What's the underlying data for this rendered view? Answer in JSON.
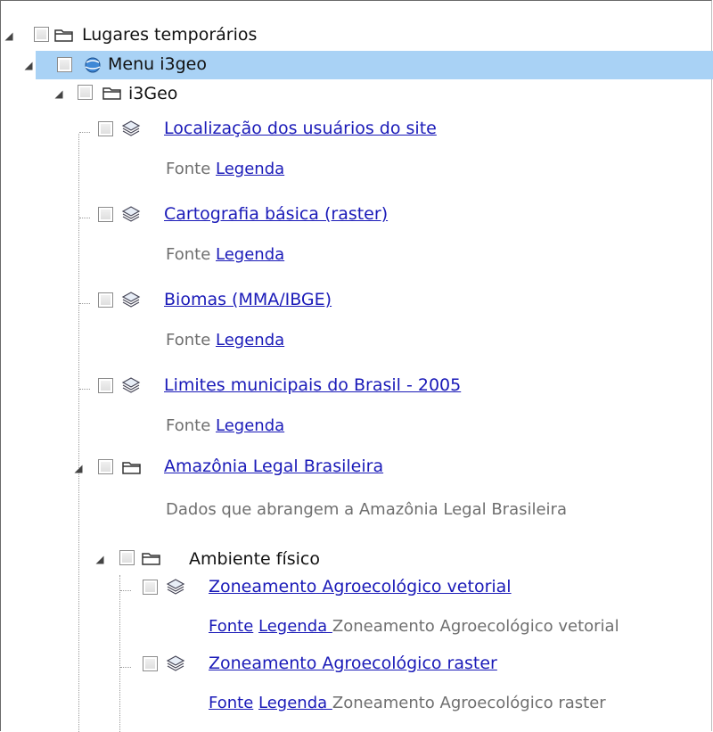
{
  "tree": {
    "root": {
      "label": "Lugares temporários"
    },
    "menu": {
      "label": "Menu i3geo"
    },
    "i3geo": {
      "label": "i3Geo"
    },
    "layers": [
      {
        "title": "Localização dos usuários do site",
        "fonte": "Fonte",
        "legenda": "Legenda "
      },
      {
        "title": "Cartografia básica (raster)",
        "fonte": "Fonte",
        "legenda": "Legenda "
      },
      {
        "title": "Biomas (MMA/IBGE)",
        "fonte": "Fonte",
        "legenda": "Legenda "
      },
      {
        "title": "Limites municipais do Brasil - 2005",
        "fonte": "Fonte",
        "legenda": "Legenda "
      }
    ],
    "amazonia": {
      "title": "Amazônia Legal Brasileira",
      "description": "Dados que abrangem a Amazônia Legal Brasileira"
    },
    "ambiente": {
      "label": "Ambiente físico"
    },
    "sublayers": [
      {
        "title": "Zoneamento Agroecológico vetorial",
        "fonte": "Fonte",
        "legenda": "Legenda ",
        "desc": "Zoneamento Agroecológico vetorial"
      },
      {
        "title": "Zoneamento Agroecológico raster",
        "fonte": "Fonte",
        "legenda": "Legenda ",
        "desc": "Zoneamento Agroecológico raster"
      }
    ]
  },
  "colors": {
    "selected_row": "#a9d2f5",
    "link": "#1a1ab8",
    "muted_text": "#6f6f6f"
  }
}
